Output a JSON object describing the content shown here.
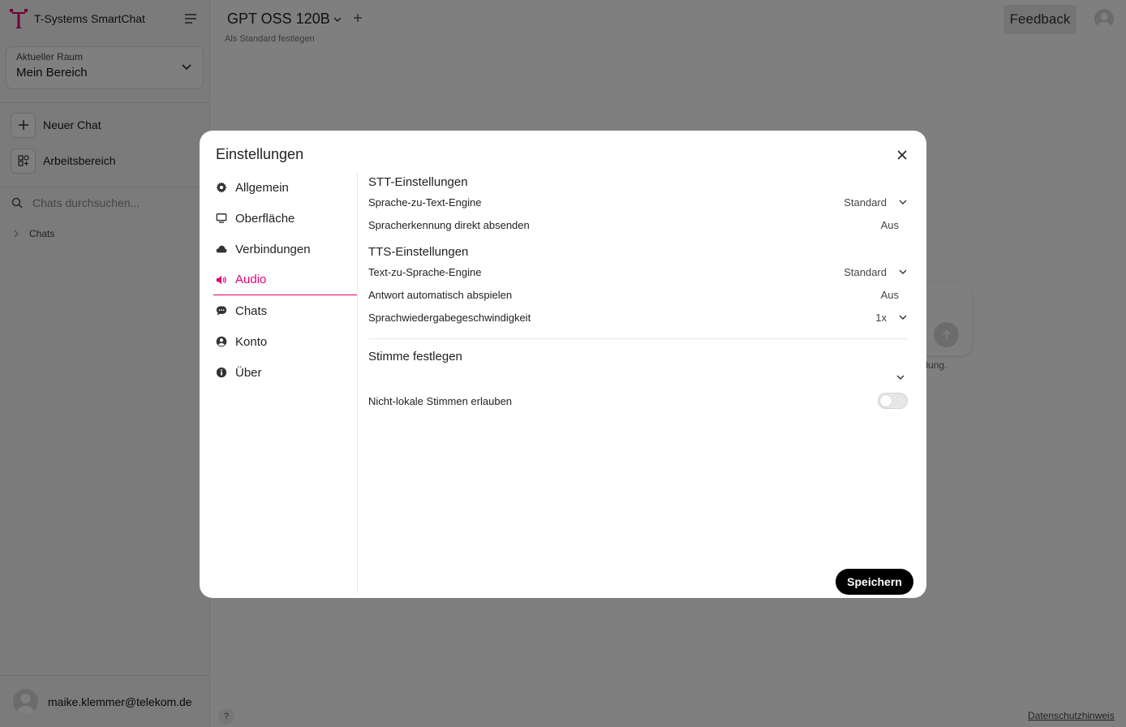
{
  "app": {
    "brand_name": "T-Systems SmartChat"
  },
  "sidebar": {
    "room_label": "Aktueller Raum",
    "room_value": "Mein Bereich",
    "new_chat": "Neuer Chat",
    "workspace": "Arbeitsbereich",
    "search_placeholder": "Chats durchsuchen...",
    "chats_folder": "Chats",
    "user_email": "maike.klemmer@telekom.de"
  },
  "header": {
    "model": "GPT OSS 120B",
    "set_default": "Als Standard festlegen",
    "feedback": "Feedback"
  },
  "background": {
    "hint_fragment": "endung.",
    "help": "?",
    "privacy": "Datenschutzhinweis"
  },
  "settings": {
    "title": "Einstellungen",
    "nav": [
      {
        "label": "Allgemein",
        "icon": "gear-icon"
      },
      {
        "label": "Oberfläche",
        "icon": "monitor-icon"
      },
      {
        "label": "Verbindungen",
        "icon": "cloud-icon"
      },
      {
        "label": "Audio",
        "icon": "speaker-icon",
        "active": true
      },
      {
        "label": "Chats",
        "icon": "chat-bubble-icon"
      },
      {
        "label": "Konto",
        "icon": "user-circle-icon"
      },
      {
        "label": "Über",
        "icon": "info-icon"
      }
    ],
    "stt": {
      "title": "STT-Einstellungen",
      "engine_label": "Sprache-zu-Text-Engine",
      "engine_value": "Standard",
      "auto_send_label": "Spracherkennung direkt absenden",
      "auto_send_value": "Aus"
    },
    "tts": {
      "title": "TTS-Einstellungen",
      "engine_label": "Text-zu-Sprache-Engine",
      "engine_value": "Standard",
      "autoplay_label": "Antwort automatisch abspielen",
      "autoplay_value": "Aus",
      "speed_label": "Sprachwiedergabegeschwindigkeit",
      "speed_value": "1x"
    },
    "voice": {
      "title": "Stimme festlegen",
      "nonlocal_label": "Nicht-lokale Stimmen erlauben",
      "nonlocal_enabled": false
    },
    "save": "Speichern"
  },
  "colors": {
    "accent": "#e20074",
    "overlay": "rgba(0,0,0,0.5)"
  }
}
